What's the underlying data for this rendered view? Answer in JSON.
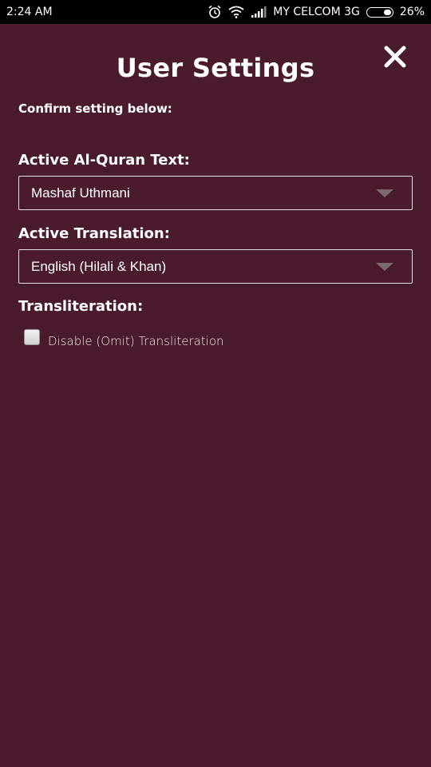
{
  "status_bar": {
    "time": "2:24 AM",
    "carrier": "MY CELCOM 3G",
    "battery": "26%",
    "icons": [
      "alarm-icon",
      "wifi-icon",
      "signal-icon",
      "battery-icon"
    ]
  },
  "header": {
    "title": "User Settings",
    "close_icon": "close-icon"
  },
  "form": {
    "intro": "Confirm setting below:",
    "quran_text": {
      "label": "Active Al-Quran Text:",
      "selected": "Mashaf Uthmani"
    },
    "translation": {
      "label": "Active Translation:",
      "selected": "English (Hilali & Khan)"
    },
    "transliteration": {
      "label": "Transliteration:",
      "checkbox_label": "Disable (Omit) Transliteration",
      "checked": false
    }
  },
  "colors": {
    "background": "#4a1a2e",
    "text": "#ffffff",
    "status_bar": "#000000"
  }
}
